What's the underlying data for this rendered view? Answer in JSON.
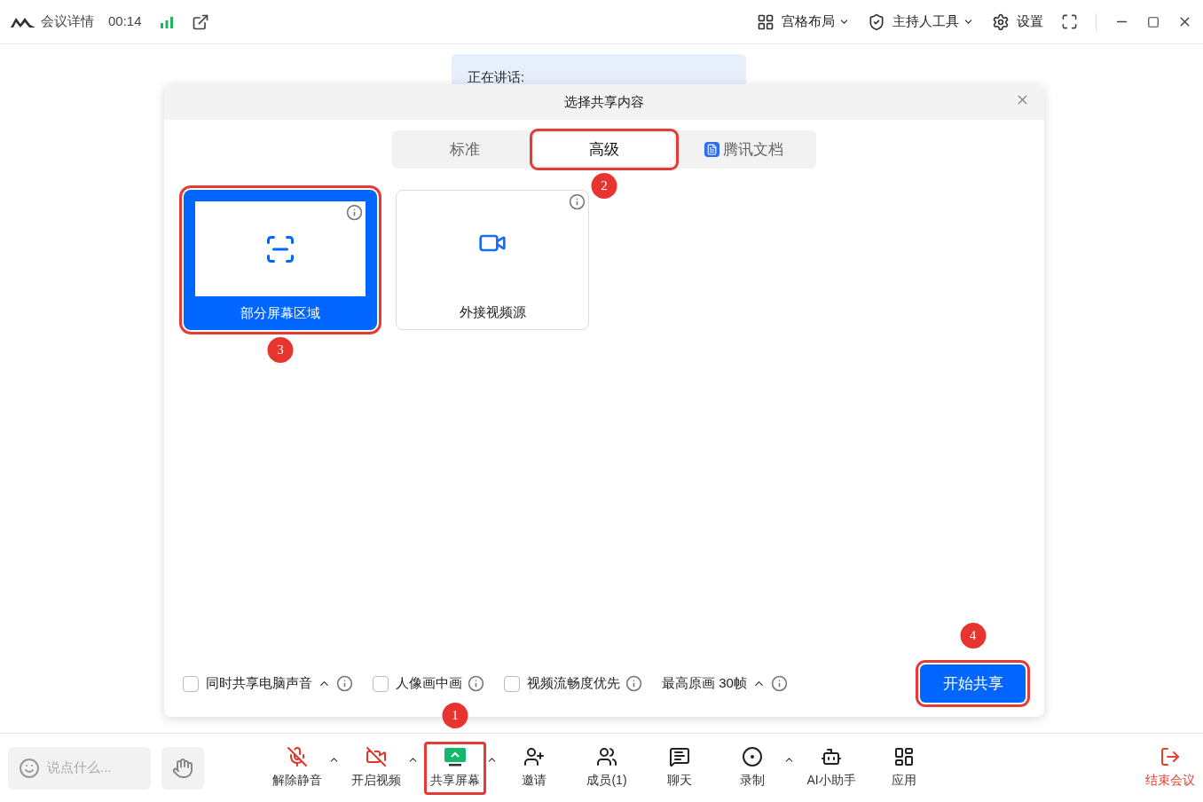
{
  "title_bar": {
    "meeting_info": "会议详情",
    "time": "00:14",
    "menus": [
      {
        "label": "宫格布局",
        "kind": "grid"
      },
      {
        "label": "主持人工具",
        "kind": "shield"
      },
      {
        "label": "设置",
        "kind": "gear"
      }
    ]
  },
  "speaking_banner": "正在讲话:",
  "dialog": {
    "title": "选择共享内容",
    "tabs": [
      {
        "label": "标准",
        "selected": false,
        "highlighted": false
      },
      {
        "label": "高级",
        "selected": true,
        "highlighted": true,
        "step": "2"
      },
      {
        "label": "腾讯文档",
        "selected": false,
        "highlighted": false,
        "kind": "docs"
      }
    ],
    "sources": [
      {
        "label": "部分屏幕区域",
        "kind": "region",
        "selected": true,
        "highlighted": true,
        "step": "3"
      },
      {
        "label": "外接视频源",
        "kind": "camera",
        "selected": false,
        "highlighted": false
      }
    ],
    "options": [
      {
        "label": "同时共享电脑声音",
        "kind": "checkbox",
        "checked": false,
        "caret": true
      },
      {
        "label": "人像画中画",
        "kind": "checkbox",
        "checked": false,
        "caret": false
      },
      {
        "label": "视频流畅度优先",
        "kind": "checkbox",
        "checked": false,
        "caret": false
      },
      {
        "label": "最高原画 30帧",
        "kind": "dropdown",
        "caret": true
      }
    ],
    "start_button": {
      "label": "开始共享",
      "highlighted": true,
      "step": "4"
    }
  },
  "toolbar": {
    "chat_placeholder": "说点什么...",
    "buttons": [
      {
        "label": "解除静音",
        "kind": "mic-off",
        "caret": true,
        "highlighted": false
      },
      {
        "label": "开启视频",
        "kind": "video-off",
        "caret": true,
        "highlighted": false
      },
      {
        "label": "共享屏幕",
        "kind": "share",
        "caret": true,
        "highlighted": true,
        "step": "1"
      },
      {
        "label": "邀请",
        "kind": "invite",
        "caret": false,
        "highlighted": false
      },
      {
        "label": "成员(1)",
        "kind": "members",
        "caret": false,
        "highlighted": false
      },
      {
        "label": "聊天",
        "kind": "chat",
        "caret": false,
        "highlighted": false
      },
      {
        "label": "录制",
        "kind": "record",
        "caret": true,
        "highlighted": false
      },
      {
        "label": "AI小助手",
        "kind": "ai",
        "caret": false,
        "highlighted": false
      },
      {
        "label": "应用",
        "kind": "apps",
        "caret": false,
        "highlighted": false
      }
    ],
    "end_button": "结束会议"
  }
}
